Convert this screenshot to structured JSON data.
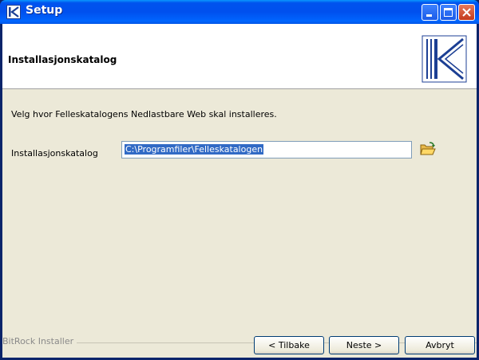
{
  "window": {
    "title": "Setup"
  },
  "header": {
    "title": "Installasjonskatalog"
  },
  "body": {
    "instruction": "Velg hvor Felleskatalogens Nedlastbare Web skal installeres.",
    "directory_label": "Installasjonskatalog",
    "directory_value": "C:\\Programfiler\\Felleskatalogen"
  },
  "footer": {
    "group_label": "BitRock Installer",
    "back_label": "< Tilbake",
    "next_label": "Neste >",
    "cancel_label": "Avbryt"
  },
  "icons": {
    "app": "k-logo-icon",
    "minimize": "minimize-icon",
    "maximize": "maximize-icon",
    "close": "close-icon",
    "browse": "open-folder-icon"
  },
  "colors": {
    "titlebar": "#0053ee",
    "selection": "#316ac5",
    "header_bg": "#ffffff",
    "body_bg": "#ece9d8",
    "logo_blue": "#1c3f94"
  }
}
